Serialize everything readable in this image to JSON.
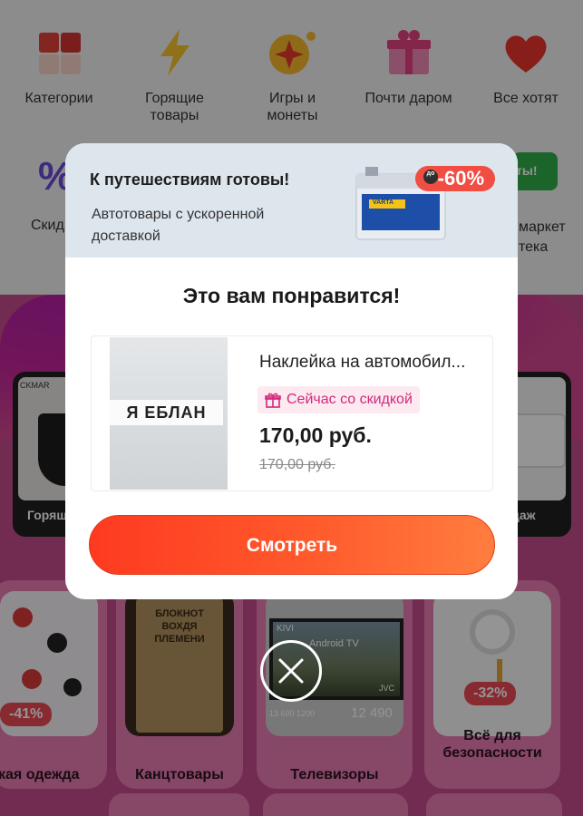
{
  "categories": [
    {
      "label": "Категории",
      "icon": "categories-icon"
    },
    {
      "label": "Горящие товары",
      "icon": "lightning-icon"
    },
    {
      "label": "Игры и монеты",
      "icon": "coin-icon"
    },
    {
      "label": "Почти даром",
      "icon": "gift-icon"
    },
    {
      "label": "Все хотят",
      "icon": "heart-icon"
    }
  ],
  "categories_row2": {
    "left_label": "Скид",
    "right_label_1": "маркет",
    "right_label_2": "тека",
    "right_badge": "ты!"
  },
  "side_cards": {
    "left_label": "Горяш",
    "left_brand": "CKMAR",
    "right_label": "даж"
  },
  "tiles": [
    {
      "name": "кая одежда",
      "discount": "-41%"
    },
    {
      "name": "Канцтовары",
      "overlay": "БЛОКНОТ ВОХДЯ ПЛЕМЕНИ"
    },
    {
      "name": "Телевизоры",
      "screen_brand": "KIVI",
      "screen_os": "Android TV",
      "tv_brand": "JVC",
      "tv_price": "12 490",
      "tv_small": "13 690  1200"
    },
    {
      "name": "Всё для безопасности",
      "discount": "-32%"
    }
  ],
  "modal": {
    "banner_title": "К путешествиям готовы!",
    "banner_subtitle": "Автотовары с ускоренной доставкой",
    "promo_prefix": "до",
    "promo_value": "-60%",
    "battery_brand": "VARTA",
    "title": "Это вам понравится!",
    "product": {
      "name": "Наклейка на автомобил...",
      "image_text": "Я ЕБЛАН",
      "deal_label": "Сейчас со скидкой",
      "price": "170,00 руб.",
      "old_price": "170,00 руб."
    },
    "cta_label": "Смотреть"
  },
  "colors": {
    "accent": "#ff4a24",
    "deal_pink": "#d2287c",
    "banner_bg": "#dde6ed",
    "page_pink": "#c54a8c",
    "tile_pink": "#e97ab0"
  }
}
